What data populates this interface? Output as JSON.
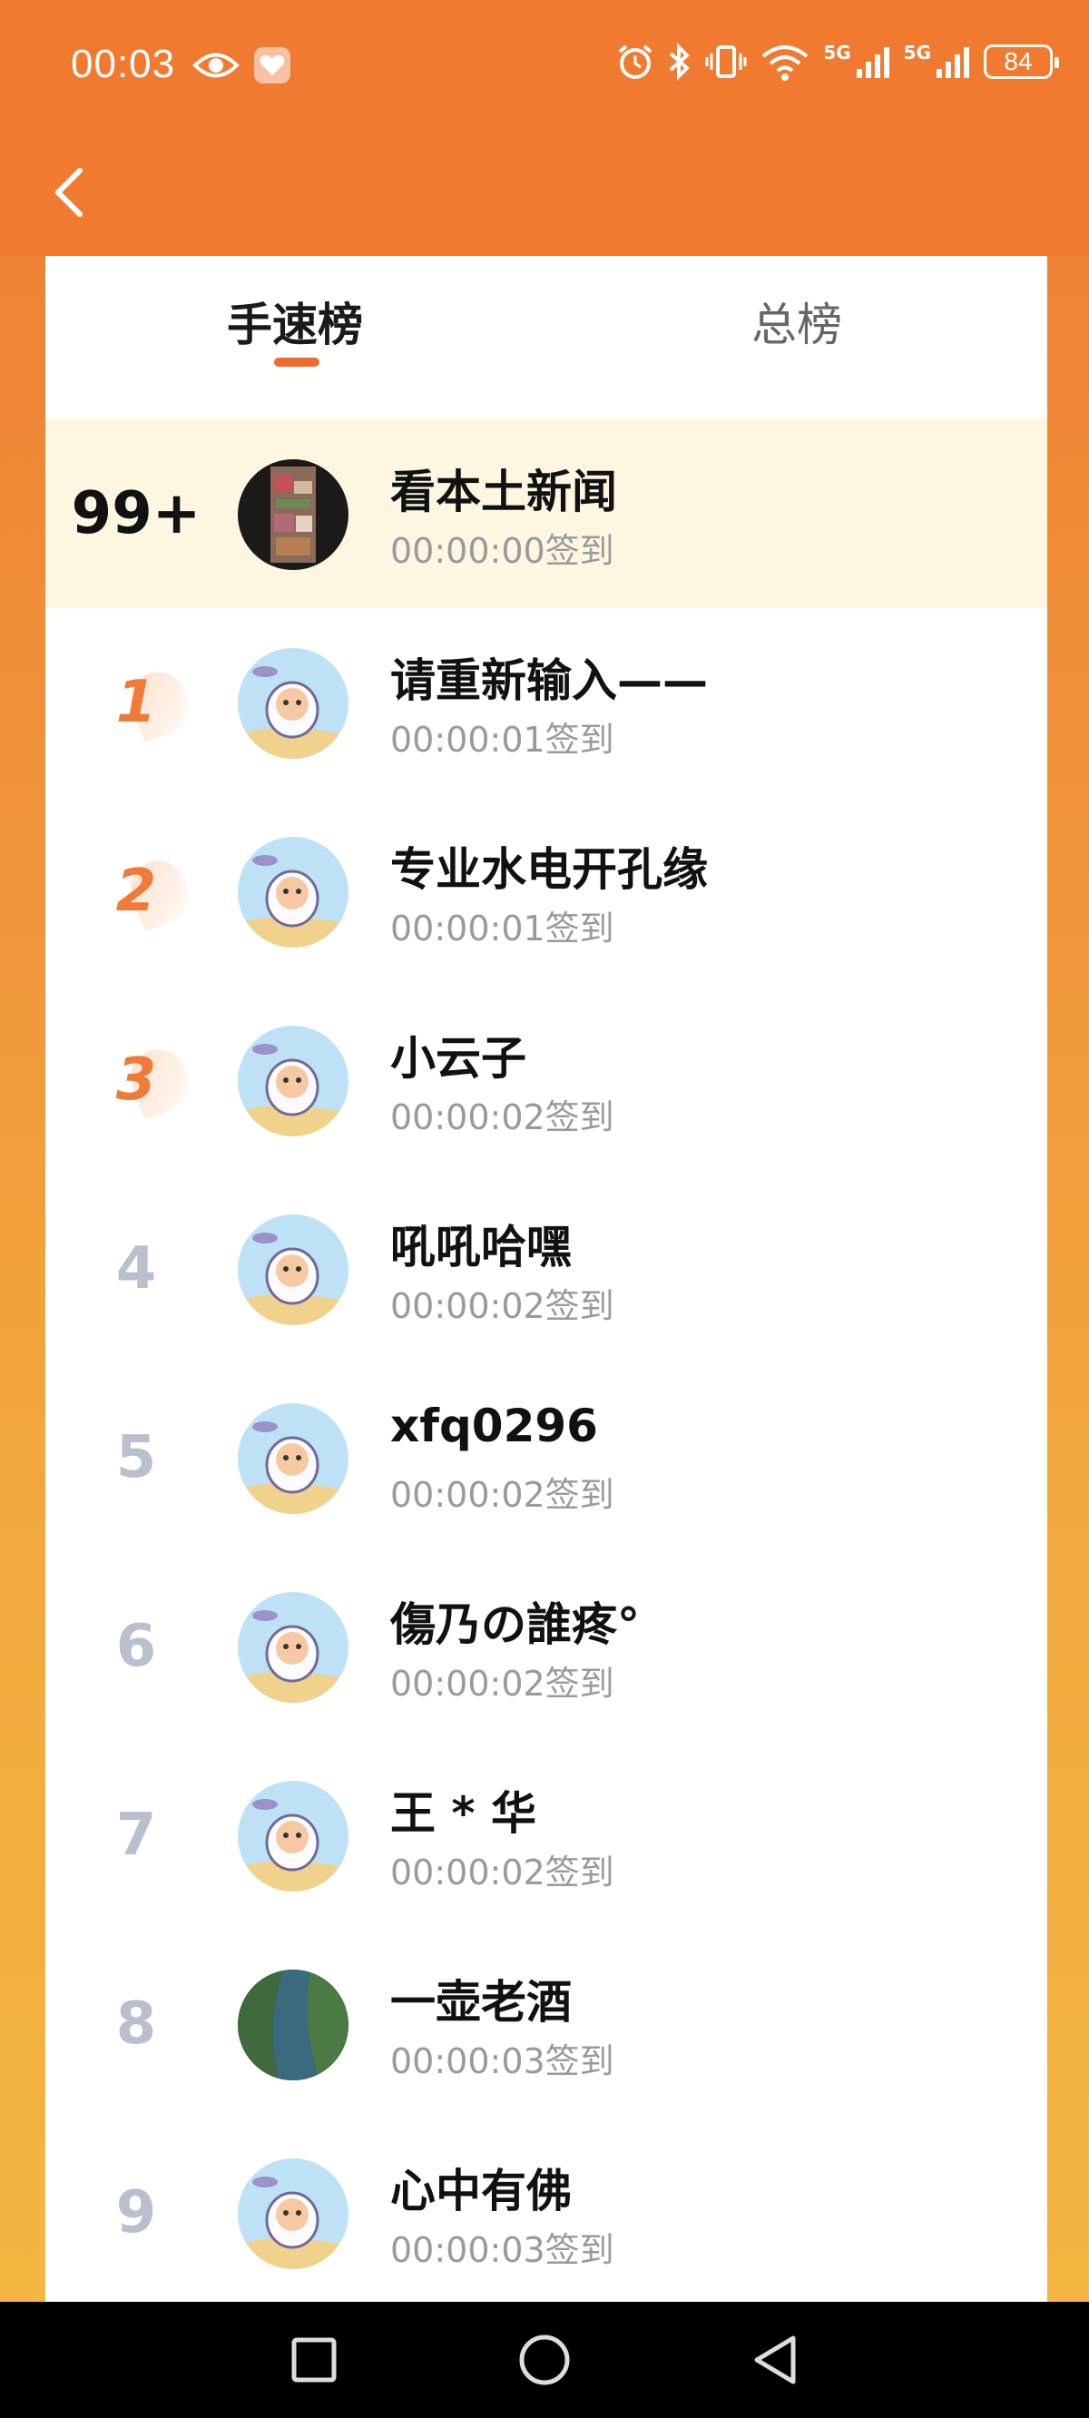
{
  "status_bar": {
    "time": "00:03",
    "battery": "84",
    "network_labels": [
      "5G",
      "5G"
    ],
    "icons": [
      "eye-icon",
      "heart-shield-icon",
      "alarm-icon",
      "bluetooth-icon",
      "vibrate-icon",
      "wifi-icon",
      "signal-icon",
      "signal-icon"
    ]
  },
  "header": {
    "back_icon": "chevron-left-icon"
  },
  "tabs": [
    {
      "label": "手速榜",
      "active": true
    },
    {
      "label": "总榜",
      "active": false
    }
  ],
  "my_entry": {
    "rank": "99+",
    "name": "看本土新闻",
    "time": "00:00:00签到"
  },
  "leaderboard": [
    {
      "rank": "1",
      "name": "请重新输入——",
      "time": "00:00:01签到"
    },
    {
      "rank": "2",
      "name": "专业水电开孔缘",
      "time": "00:00:01签到"
    },
    {
      "rank": "3",
      "name": "小云子",
      "time": "00:00:02签到"
    },
    {
      "rank": "4",
      "name": "吼吼哈嘿",
      "time": "00:00:02签到"
    },
    {
      "rank": "5",
      "name": "xfq0296",
      "time": "00:00:02签到"
    },
    {
      "rank": "6",
      "name": "傷乃の誰疼°",
      "time": "00:00:02签到"
    },
    {
      "rank": "7",
      "name": "王 * 华",
      "time": "00:00:02签到"
    },
    {
      "rank": "8",
      "name": "一壶老酒",
      "time": "00:00:03签到"
    },
    {
      "rank": "9",
      "name": "心中有佛",
      "time": "00:00:03签到"
    }
  ],
  "colors": {
    "accent": "#ef7a30",
    "top_rank": "#ef7a3a",
    "highlight_bg": "#fdf7e2",
    "rank_plain": "#b9bfcc"
  },
  "nav": [
    "square-icon",
    "circle-icon",
    "triangle-back-icon"
  ]
}
